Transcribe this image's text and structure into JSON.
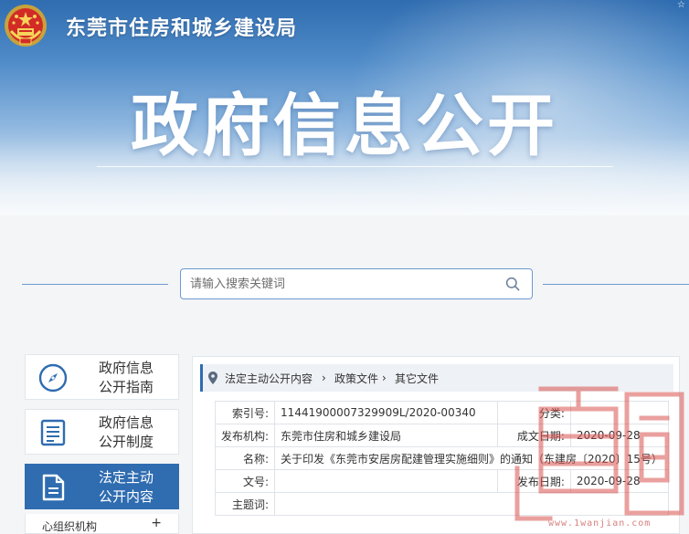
{
  "header": {
    "site_title": "东莞市住房和城乡建设局",
    "banner_title": "政府信息公开",
    "corner_glyph": "☆"
  },
  "search": {
    "placeholder": "请输入搜索关键词",
    "icon": "search-icon"
  },
  "sidebar": {
    "items": [
      {
        "label_line1": "政府信息",
        "label_line2": "公开指南",
        "icon": "compass-icon",
        "active": false
      },
      {
        "label_line1": "政府信息",
        "label_line2": "公开制度",
        "icon": "document-list-icon",
        "active": false
      },
      {
        "label_line1": "法定主动",
        "label_line2": "公开内容",
        "icon": "file-icon",
        "active": true
      }
    ],
    "sub_item": {
      "label": "心组织机构",
      "toggle": "+"
    }
  },
  "breadcrumb": {
    "items": [
      "法定主动公开内容",
      "政策文件",
      "其它文件"
    ],
    "separator": "›"
  },
  "meta": {
    "index_no_label": "索引号:",
    "index_no": "11441900007329909L/2020-00340",
    "category_label": "分类:",
    "category": "",
    "publisher_label": "发布机构:",
    "publisher": "东莞市住房和城乡建设局",
    "created_label": "成文日期:",
    "created": "2020-09-28",
    "name_label": "名称:",
    "name": "关于印发《东莞市安居房配建管理实施细则》的通知（东建房〔2020〕15号）",
    "doc_no_label": "文号:",
    "doc_no": "",
    "published_label": "发布日期:",
    "published": "2020-09-28",
    "subject_label": "主题词:",
    "subject": ""
  },
  "watermark": {
    "text": "www.1wanjian.com"
  },
  "colors": {
    "accent": "#2f6cb0",
    "border": "#6b9bd0",
    "background": "#f4f5f7"
  }
}
